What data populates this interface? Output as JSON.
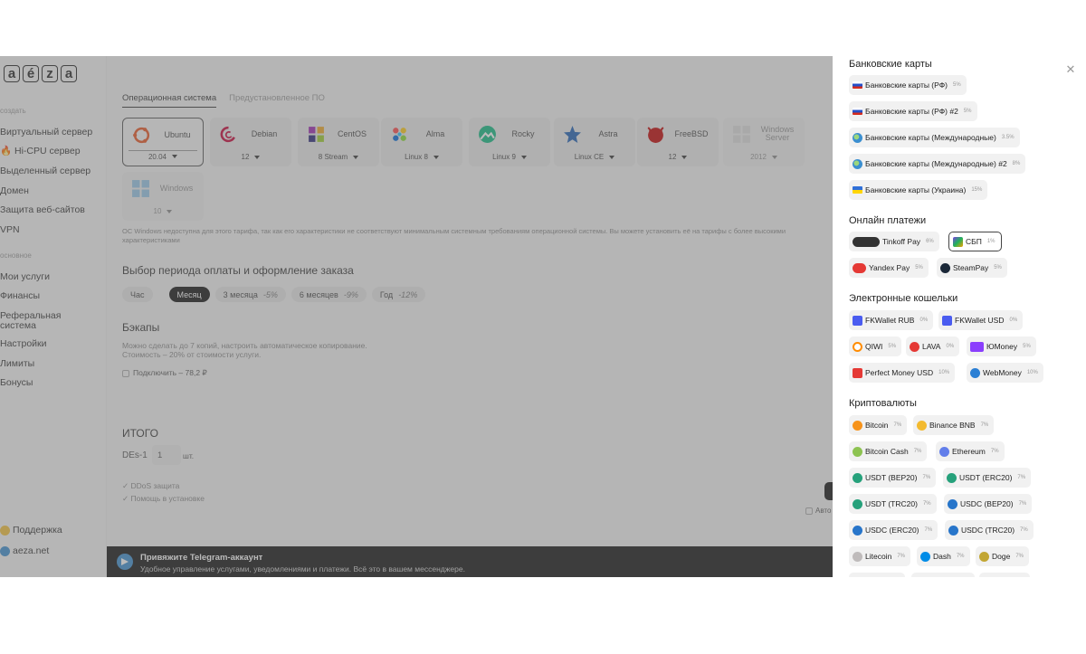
{
  "sidebar": {
    "logo_letters": [
      "a",
      "é",
      "z",
      "a"
    ],
    "section_create": "создать",
    "create_items": [
      "Виртуальный сервер",
      "🔥 Hi-CPU сервер",
      "Выделенный сервер",
      "Домен",
      "Защита веб-сайтов",
      "VPN"
    ],
    "section_main": "основное",
    "main_items": [
      "Мои услуги",
      "Финансы",
      "Реферальная система",
      "Настройки",
      "Лимиты",
      "Бонусы"
    ],
    "support": "Поддержка",
    "site": "aeza.net"
  },
  "main": {
    "tabs": [
      "Операционная система",
      "Предустановленное ПО"
    ],
    "os": [
      {
        "name": "Ubuntu",
        "version": "20.04",
        "color": "#e95420",
        "icon": "ubuntu-logo"
      },
      {
        "name": "Debian",
        "version": "12",
        "color": "#c70036",
        "icon": "debian-logo"
      },
      {
        "name": "CentOS",
        "version": "8 Stream",
        "color": "#9c27b0",
        "icon": "centos-logo"
      },
      {
        "name": "Alma",
        "version": "Linux 8",
        "color": "#ff9800",
        "icon": "alma-logo"
      },
      {
        "name": "Rocky",
        "version": "Linux 9",
        "color": "#10b981",
        "icon": "rocky-logo"
      },
      {
        "name": "Astra",
        "version": "Linux CE",
        "color": "#1e5fb4",
        "icon": "astra-logo"
      },
      {
        "name": "FreeBSD",
        "version": "12",
        "color": "#c00000",
        "icon": "freebsd-logo"
      },
      {
        "name": "Windows Server",
        "version": "2012",
        "color": "#cccccc",
        "icon": "windows-logo"
      },
      {
        "name": "Windows",
        "version": "10",
        "color": "#4aa3df",
        "icon": "windows-logo"
      }
    ],
    "windows_note": "ОС Windows недоступна для этого тарифа, так как его характеристики не соответствуют минимальным системным требованиям операционной системы. Вы можете установить её на тарифы с более высокими характеристиками",
    "period_title": "Выбор периода оплаты и оформление заказа",
    "periods": [
      {
        "label": "Час",
        "discount": ""
      },
      {
        "label": "Месяц",
        "discount": ""
      },
      {
        "label": "3 месяца",
        "discount": "-5%"
      },
      {
        "label": "6 месяцев",
        "discount": "-9%"
      },
      {
        "label": "Год",
        "discount": "-12%"
      }
    ],
    "backups_title": "Бэкапы",
    "backups_text": "Можно сделать до 7 копий, настроить автоматическое копирование.",
    "backups_cost": "Стоимость – 20% от стоимости услуги.",
    "backups_connect": "Подключить – 78,2 ₽",
    "total_title": "ИТОГО",
    "total_plan": "DEs-1",
    "total_qty": "1",
    "total_unit": "шт.",
    "features": [
      "DDoS защита",
      "Помощь в установке"
    ],
    "auto_text": "Авто",
    "telegram_title": "Привяжите Telegram-аккаунт",
    "telegram_text": "Удобное управление услугами, уведомлениями и платежи. Всё это в вашем мессенджере."
  },
  "panel": {
    "categories": {
      "bank": "Банковские карты",
      "online": "Онлайн платежи",
      "wallets": "Электронные кошельки",
      "crypto": "Криптовалюты"
    },
    "bank": [
      {
        "label": "Банковские карты (РФ)",
        "fee": "5%",
        "icon": "russia-flag-icon"
      },
      {
        "label": "Банковские карты (РФ) #2",
        "fee": "5%",
        "icon": "russia-flag-icon"
      },
      {
        "label": "Банковские карты (Международные)",
        "fee": "3.5%",
        "icon": "globe-icon"
      },
      {
        "label": "Банковские карты (Международные) #2",
        "fee": "8%",
        "icon": "globe-icon"
      },
      {
        "label": "Банковские карты (Украина)",
        "fee": "15%",
        "icon": "ukraine-flag-icon"
      }
    ],
    "online": [
      {
        "label": "Tinkoff Pay",
        "fee": "6%",
        "icon": "tinkoff-pay-icon",
        "color": "#333333"
      },
      {
        "label": "СБП",
        "fee": "1%",
        "icon": "sbp-icon",
        "color": "#7b3fe4",
        "selected": true
      },
      {
        "label": "Yandex Pay",
        "fee": "5%",
        "icon": "yandex-pay-icon",
        "color": "#e53935"
      },
      {
        "label": "SteamPay",
        "fee": "5%",
        "icon": "steam-icon",
        "color": "#1b2838"
      }
    ],
    "wallets": [
      {
        "label": "FKWallet RUB",
        "fee": "0%",
        "icon": "fkwallet-icon",
        "color": "#4a5cf0"
      },
      {
        "label": "FKWallet USD",
        "fee": "0%",
        "icon": "fkwallet-icon",
        "color": "#4a5cf0"
      },
      {
        "label": "QIWI",
        "fee": "5%",
        "icon": "qiwi-icon",
        "color": "#ff8c00"
      },
      {
        "label": "LAVA",
        "fee": "0%",
        "icon": "lava-icon",
        "color": "#e53935"
      },
      {
        "label": "ЮMoney",
        "fee": "5%",
        "icon": "yoomoney-icon",
        "color": "#8b3ffd"
      },
      {
        "label": "Perfect Money USD",
        "fee": "10%",
        "icon": "perfect-money-icon",
        "color": "#e53935"
      },
      {
        "label": "WebMoney",
        "fee": "10%",
        "icon": "webmoney-icon",
        "color": "#2b7fd4"
      }
    ],
    "crypto": [
      {
        "label": "Bitcoin",
        "fee": "7%",
        "icon": "bitcoin-icon",
        "color": "#f7931a"
      },
      {
        "label": "Binance BNB",
        "fee": "7%",
        "icon": "bnb-icon",
        "color": "#f3ba2f"
      },
      {
        "label": "Bitcoin Cash",
        "fee": "7%",
        "icon": "bitcoin-cash-icon",
        "color": "#8dc351"
      },
      {
        "label": "Ethereum",
        "fee": "7%",
        "icon": "ethereum-icon",
        "color": "#627eea"
      },
      {
        "label": "USDT (BEP20)",
        "fee": "7%",
        "icon": "tether-icon",
        "color": "#26a17b"
      },
      {
        "label": "USDT (ERC20)",
        "fee": "7%",
        "icon": "tether-icon",
        "color": "#26a17b"
      },
      {
        "label": "USDT (TRC20)",
        "fee": "7%",
        "icon": "tether-icon",
        "color": "#26a17b"
      },
      {
        "label": "USDC (BEP20)",
        "fee": "7%",
        "icon": "usdc-icon",
        "color": "#2775ca"
      },
      {
        "label": "USDC (ERC20)",
        "fee": "7%",
        "icon": "usdc-icon",
        "color": "#2775ca"
      },
      {
        "label": "USDC (TRC20)",
        "fee": "7%",
        "icon": "usdc-icon",
        "color": "#2775ca"
      },
      {
        "label": "Litecoin",
        "fee": "7%",
        "icon": "litecoin-icon",
        "color": "#bfbbbb"
      },
      {
        "label": "Dash",
        "fee": "7%",
        "icon": "dash-icon",
        "color": "#008ce7"
      },
      {
        "label": "Doge",
        "fee": "7%",
        "icon": "doge-icon",
        "color": "#c2a633"
      }
    ]
  }
}
